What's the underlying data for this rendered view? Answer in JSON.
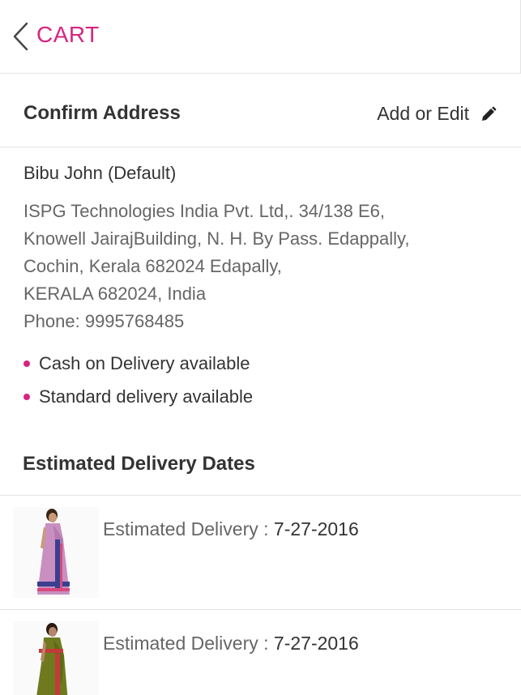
{
  "header": {
    "title": "CART",
    "accent_color": "#d6247f",
    "back_icon": "chevron-left-icon"
  },
  "address_section": {
    "title": "Confirm Address",
    "edit_label": "Add or Edit",
    "edit_icon": "pencil-icon"
  },
  "address": {
    "name": "Bibu John (Default)",
    "lines": [
      "ISPG Technologies India Pvt. Ltd,. 34/138 E6,",
      "Knowell JairajBuilding, N. H. By Pass. Edappally,",
      "Cochin, Kerala 682024 Edapally,",
      "KERALA 682024, India",
      "Phone: 9995768485"
    ]
  },
  "delivery_options": [
    "Cash on Delivery available",
    "Standard delivery available"
  ],
  "estimated_section": {
    "title": "Estimated Delivery Dates"
  },
  "items": [
    {
      "label": "Estimated Delivery : ",
      "date": "7-27-2016",
      "saree_color": "#c98fc0",
      "border_color": "#3a3f8f"
    },
    {
      "label": "Estimated Delivery : ",
      "date": "7-27-2016",
      "saree_color": "#6f7a1e",
      "border_color": "#c43a3a"
    }
  ]
}
